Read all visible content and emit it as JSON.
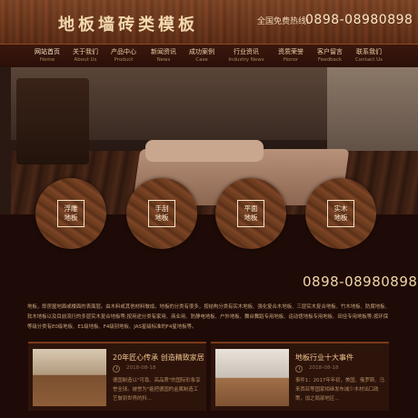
{
  "header": {
    "title": "地板墙砖类模板",
    "hotline_label": "全国免费热线:",
    "hotline_number": "0898-08980898"
  },
  "nav": {
    "items": [
      {
        "zh": "网站首页",
        "en": "Home"
      },
      {
        "zh": "关于我们",
        "en": "About Us"
      },
      {
        "zh": "产品中心",
        "en": "Product"
      },
      {
        "zh": "新闻资讯",
        "en": "News"
      },
      {
        "zh": "成功案例",
        "en": "Case"
      },
      {
        "zh": "行业资讯",
        "en": "Industry News"
      },
      {
        "zh": "资质荣誉",
        "en": "Honor"
      },
      {
        "zh": "客户留言",
        "en": "Feedback"
      },
      {
        "zh": "联系我们",
        "en": "Contact Us"
      }
    ]
  },
  "categories": [
    {
      "line1": "浮雕",
      "line2": "地板"
    },
    {
      "line1": "手刮",
      "line2": "地板"
    },
    {
      "line1": "平面",
      "line2": "地板"
    },
    {
      "line1": "实木",
      "line2": "地板"
    }
  ],
  "contact": {
    "phone": "0898-08980898"
  },
  "intro": {
    "text": "地板，即房屋地面或楼面的表面层。由木料或其他材料做成。地板的分类有很多，按结构分类有实木地板、强化复合木地板、三层实木复合地板、竹木地板、防腐地板、软木地板以及目前流行的多层实木复合地板等;按用途分类有家用、商业用、防静电地板、户外地板、舞台舞蹈专用地板、运动馆地板专用地板、田径专用地板等;按环保等级分类有E0级地板、E1级地板、F4级别地板、JAS星级标准的F4星地板等。"
  },
  "news": [
    {
      "title": "20年匠心传承 创造精致家居",
      "date": "2018-08-18",
      "body": "德国制造以\"可靠、高品质\"的国际形象享誉全球。被誉为\"能把德国的金属制造工艺做到世界的科..."
    },
    {
      "title": "地板行业十大事件",
      "date": "2018-08-18",
      "body": "事件1：2017年年初，美国、俄罗斯、马来西亚等国家相继发布减少木材出口政策，加之局部地区..."
    }
  ]
}
